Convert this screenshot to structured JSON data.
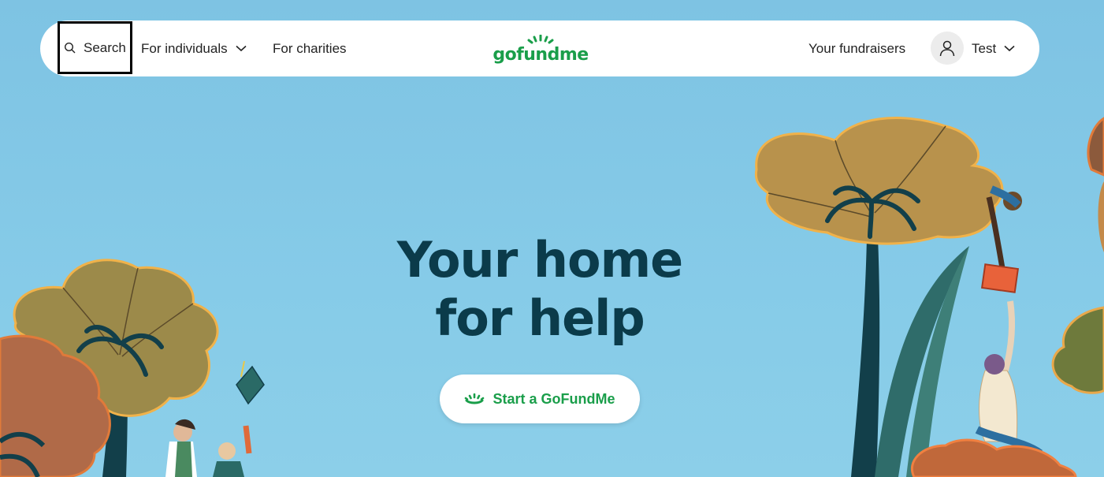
{
  "nav": {
    "search_label": "Search",
    "individuals_label": "For individuals",
    "charities_label": "For charities",
    "logo_text": "gofundme",
    "fundraisers_label": "Your fundraisers",
    "user_name": "Test"
  },
  "hero": {
    "title_line1": "Your home",
    "title_line2": "for help",
    "cta_label": "Start a GoFundMe"
  },
  "colors": {
    "brand_green": "#1a9e4a",
    "hero_text": "#0b3b4a",
    "sky": "#86cbe8"
  },
  "icons": [
    "search-icon",
    "chevron-down-icon",
    "user-icon",
    "gofundme-sun-icon"
  ]
}
